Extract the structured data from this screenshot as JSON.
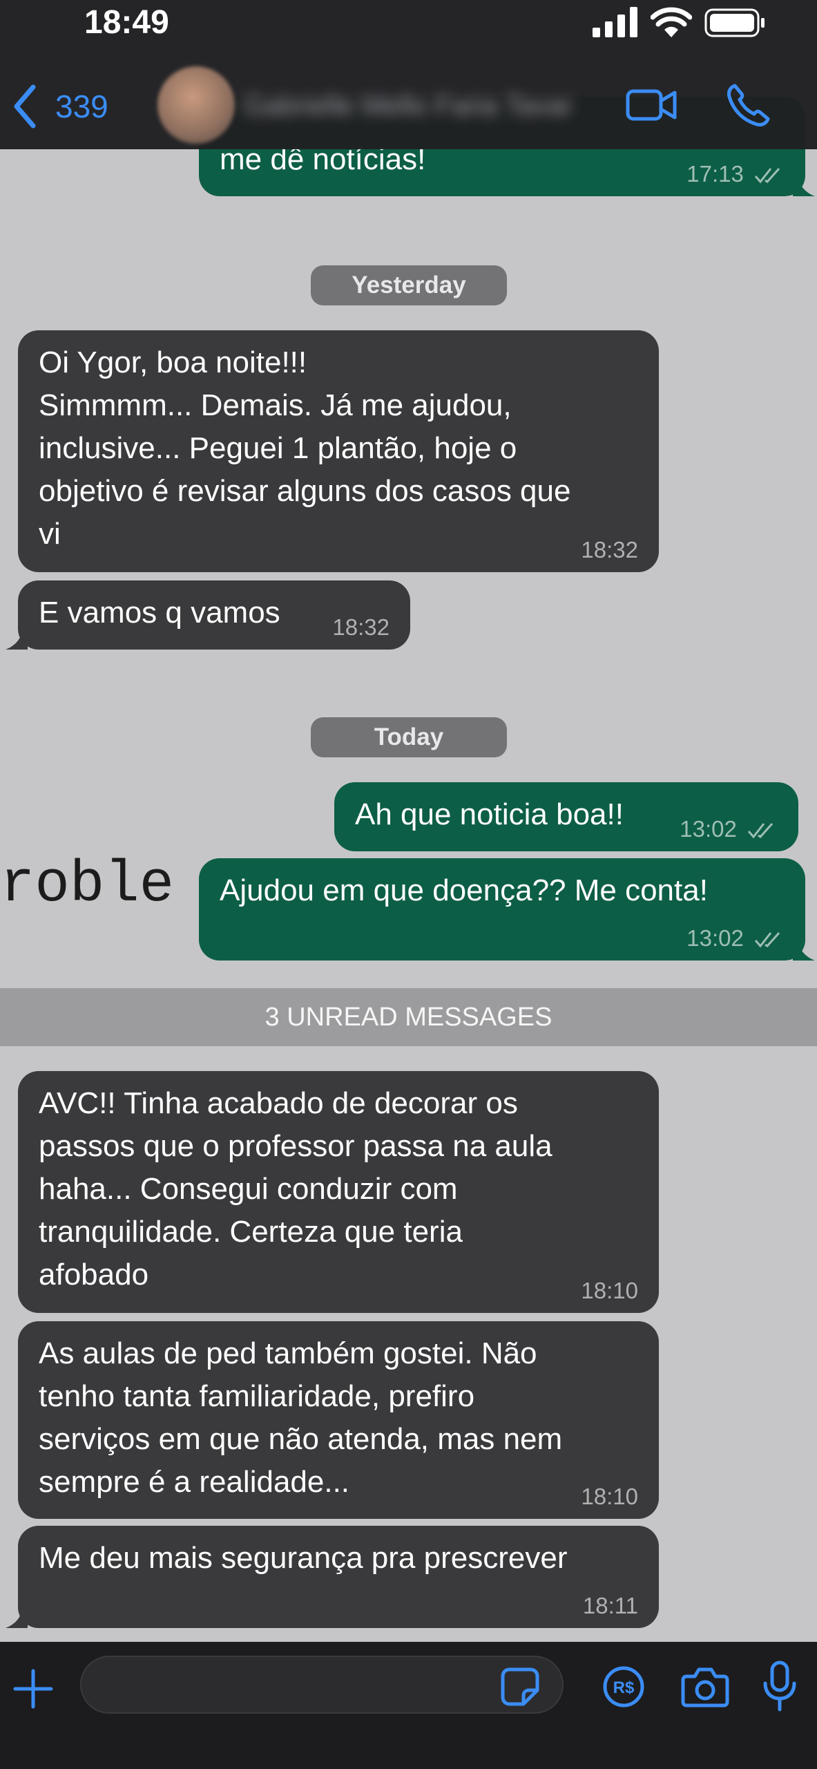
{
  "status_bar": {
    "time": "18:49"
  },
  "header": {
    "back_count": "339",
    "contact_name": "Gabrielle Mello Faria Tavar"
  },
  "messages": [
    {
      "direction": "out",
      "text": "me dê notícias!",
      "time": "17:13"
    },
    {
      "type": "date",
      "label": "Yesterday"
    },
    {
      "direction": "in",
      "text": "Oi Ygor, boa noite!!!\nSimmmm... Demais. Já me ajudou,\ninclusive... Peguei 1 plantão, hoje o\nobjetivo é revisar alguns dos casos que\nvi",
      "time": "18:32"
    },
    {
      "direction": "in",
      "text": "E vamos q vamos",
      "time": "18:32"
    },
    {
      "type": "date",
      "label": "Today"
    },
    {
      "direction": "out",
      "text": "Ah que noticia boa!!",
      "time": "13:02"
    },
    {
      "direction": "out",
      "text": "Ajudou em que doença?? Me conta!",
      "time": "13:02"
    },
    {
      "type": "unread",
      "label": "3 UNREAD MESSAGES"
    },
    {
      "direction": "in",
      "text": "AVC!! Tinha acabado de decorar os\npassos que o professor passa na aula\nhaha... Consegui conduzir com\ntranquilidade. Certeza que teria\nafobado",
      "time": "18:10"
    },
    {
      "direction": "in",
      "text": "As aulas de ped também gostei. Não\ntenho tanta familiaridade, prefiro\nserviços em que não atenda, mas nem\nsempre é a realidade...",
      "time": "18:10"
    },
    {
      "direction": "in",
      "text": "Me deu mais segurança pra prescrever",
      "time": "18:11"
    }
  ],
  "background_overlay_text": "roble",
  "input": {
    "value": ""
  },
  "colors": {
    "accent": "#3b8df5",
    "incoming_bubble": "#3a3a3c",
    "outgoing_bubble": "#0d5e46",
    "chat_background": "#c6c6c8"
  },
  "icons": [
    "signal-icon",
    "wifi-icon",
    "battery-icon",
    "back-chevron-icon",
    "video-call-icon",
    "phone-call-icon",
    "plus-icon",
    "sticker-icon",
    "payment-icon",
    "camera-icon",
    "microphone-icon",
    "double-check-icon"
  ]
}
